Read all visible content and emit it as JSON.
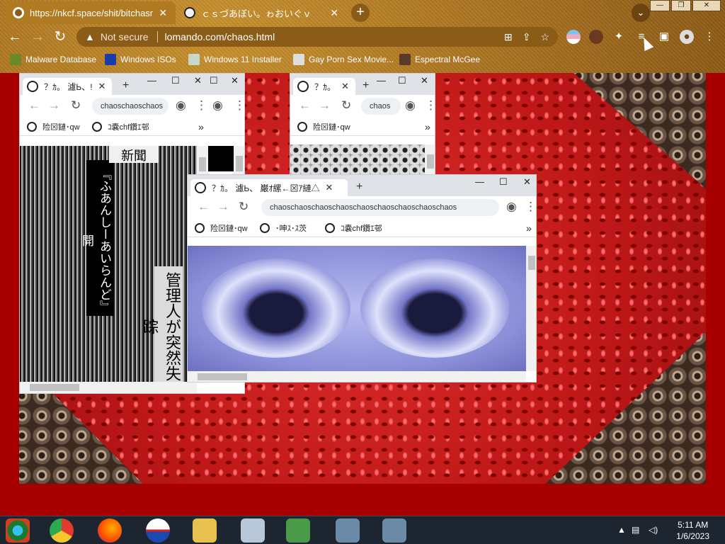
{
  "browser": {
    "tabs": [
      {
        "title": "https://nkcf.space/shit/bitchasm",
        "close": "✕"
      },
      {
        "title": "ｃｓづあぼい。ゎおいぐｖ",
        "close": "✕"
      }
    ],
    "new_tab": "+",
    "window_buttons": {
      "minimize": "—",
      "maximize": "❐",
      "close": "✕"
    },
    "omnibox": {
      "warning": "Not secure",
      "url": "lomando.com/chaos.html"
    },
    "bookmarks": [
      "Malware Database",
      "Windows ISOs",
      "Windows 11 Installer",
      "Gay Porn Sex Movie...",
      "Espectral McGee"
    ]
  },
  "popup_left": {
    "tab_title": "？ｶ。 濾Ь、!",
    "url": "chaoschaoschaos",
    "bookmarks": [
      "险⊠鏈･qw",
      "ｺ嚢chf鑽ｴ邨"
    ],
    "newspaper_title": "『ふあんしーあいらんど』開",
    "newspaper_header": "新聞",
    "newspaper_body": "管理人が突然失踪"
  },
  "popup_mid": {
    "tab_title": "？ｶ。",
    "url": "chaos",
    "bookmarks": [
      "险⊠鏈･qw"
    ]
  },
  "popup_front": {
    "tab_title": "？ｶ。 濾Ь、 巌ｵ縲←⊠ｱ縺△",
    "url": "chaoschaoschaoschaoschaoschaoschaoschaoschaos",
    "bookmarks": [
      "险⊠鏈･qw",
      "･呻ｽ･ｽ茨",
      "ｺ嚢chf鑽ｴ邨"
    ]
  },
  "taskbar": {
    "time": "5:11 AM",
    "date": "1/6/2023"
  }
}
